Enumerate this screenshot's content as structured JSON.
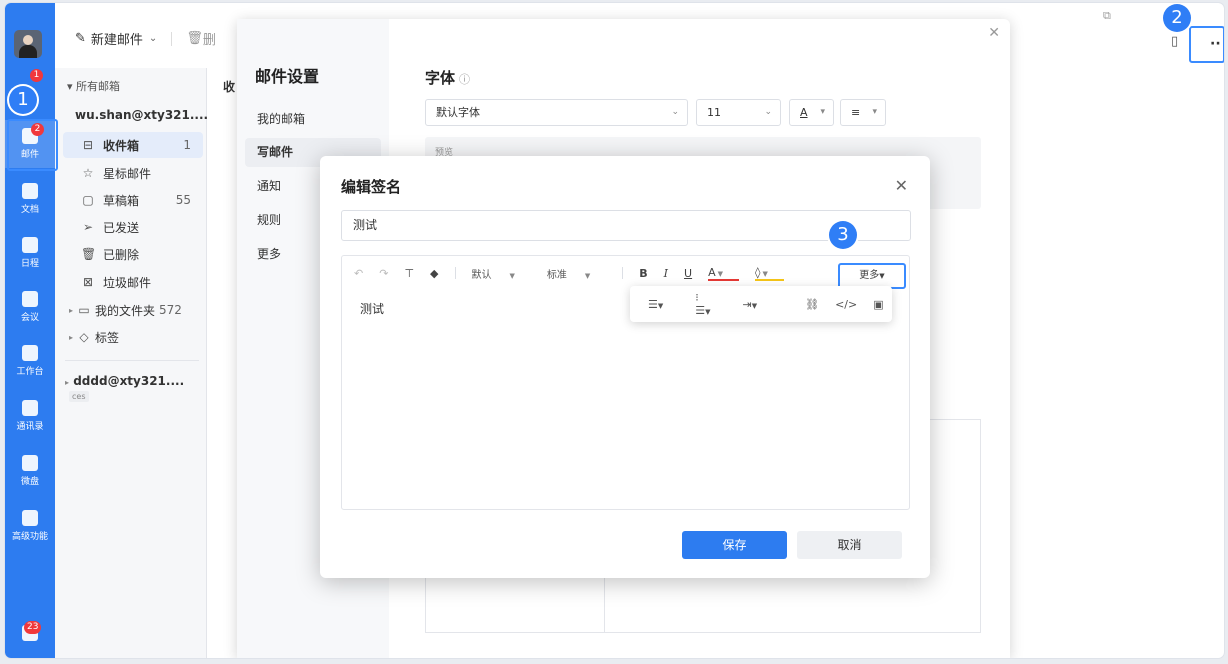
{
  "rail": {
    "items": [
      {
        "label": ""
      },
      {
        "label": "邮件",
        "badge": "2"
      },
      {
        "label": "文档"
      },
      {
        "label": "日程"
      },
      {
        "label": "会议"
      },
      {
        "label": "工作台"
      },
      {
        "label": "通讯录"
      },
      {
        "label": "微盘"
      },
      {
        "label": "高级功能"
      }
    ],
    "top_badge": "1",
    "bottom_badge": "23"
  },
  "toolbar": {
    "new_mail": "新建邮件",
    "delete": "删"
  },
  "folders": {
    "all": "所有邮箱",
    "account1": "wu.shan@xty321....",
    "items": [
      {
        "label": "收件箱",
        "count": "1",
        "icon": "inbox-icon"
      },
      {
        "label": "星标邮件",
        "count": "",
        "icon": "star-icon"
      },
      {
        "label": "草稿箱",
        "count": "55",
        "icon": "draft-icon"
      },
      {
        "label": "已发送",
        "count": "",
        "icon": "send-icon"
      },
      {
        "label": "已删除",
        "count": "",
        "icon": "trash-icon"
      },
      {
        "label": "垃圾邮件",
        "count": "",
        "icon": "spam-icon"
      },
      {
        "label": "我的文件夹",
        "count": "572",
        "icon": "folder-icon"
      },
      {
        "label": "标签",
        "count": "",
        "icon": "tag-icon"
      }
    ],
    "account2": "dddd@xty321....",
    "account2_tag": "ces"
  },
  "mid": {
    "label": "收"
  },
  "settings": {
    "title": "邮件设置",
    "nav": [
      "我的邮箱",
      "写邮件",
      "通知",
      "规则",
      "更多"
    ],
    "font_title": "字体",
    "font_family": "默认字体",
    "font_size": "11",
    "preview": "预览"
  },
  "dialog": {
    "title": "编辑签名",
    "name_value": "测试",
    "font_default": "默认",
    "size_default": "标准",
    "more": "更多",
    "body": "测试",
    "save": "保存",
    "cancel": "取消"
  },
  "steps": [
    "1",
    "2",
    "3"
  ]
}
